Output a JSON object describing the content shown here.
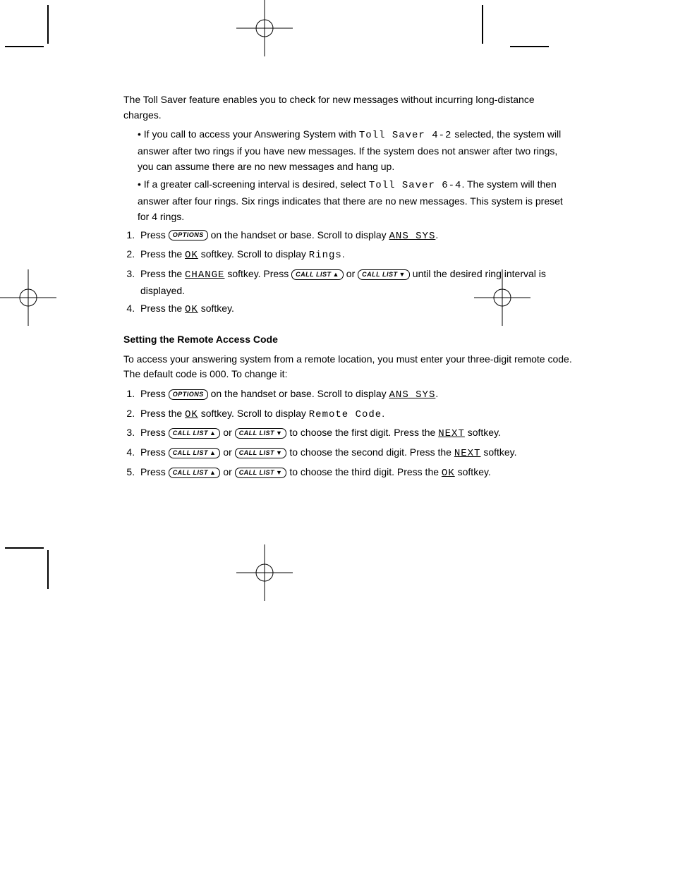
{
  "intro": {
    "l1": "The Toll Saver feature enables you to check for new messages without incurring long-distance charges.",
    "l2a": "If you call to access your Answering System with ",
    "l2b": " selected, the system will answer after two rings if you have new messages. If the system does not answer after two rings, you can assume there are no new messages and hang up.",
    "l3a": "If a greater call-screening interval is desired, select ",
    "l3b": ". The system will then answer after four rings. Six rings indicates that there are no new messages. This system is preset for 4 rings."
  },
  "lcd": {
    "tollsaver42": "Toll Saver 4-2",
    "tollsaver64": "Toll Saver 6-4",
    "ans_sys": "ANS SYS",
    "rings": "Rings",
    "remote_code": "Remote Code"
  },
  "keys": {
    "options": "OPTIONS",
    "call_list_up": "CALL LIST",
    "call_list_down": "CALL LIST"
  },
  "softkeys": {
    "ok": "OK",
    "change": "CHANGE",
    "next": "NEXT"
  },
  "rings_steps": {
    "s1a": "Press ",
    "s1b": " on the handset or base. Scroll to display ",
    "s1c": ".",
    "s2a": "Press the ",
    "s2b": " softkey. Scroll to display ",
    "s2c": ".",
    "s3a": "Press the ",
    "s3b": " softkey. Press ",
    "s3c": " or ",
    "s3d": " until the desired ring interval is displayed.",
    "s4a": "Press the ",
    "s4b": " softkey."
  },
  "remote": {
    "heading": "Setting the Remote Access Code",
    "intro": "To access your answering system from a remote location, you must enter your three-digit remote code. The default code is 000. To change it:",
    "s1a": "Press ",
    "s1b": " on the handset or base. Scroll to display ",
    "s1c": ".",
    "s2a": "Press the ",
    "s2b": " softkey. Scroll to display ",
    "s2c": ".",
    "s3a": "Press ",
    "s3b": " or ",
    "s3c": " to choose the first digit. Press the ",
    "s3d": " softkey.",
    "s4a": "Press ",
    "s4b": " or ",
    "s4c": " to choose the second digit. Press the ",
    "s4d": " softkey.",
    "s5a": "Press ",
    "s5b": " or ",
    "s5c": " to choose the third digit. Press the ",
    "s5d": " softkey."
  },
  "glyph": {
    "up": "▲",
    "down": "▼"
  }
}
